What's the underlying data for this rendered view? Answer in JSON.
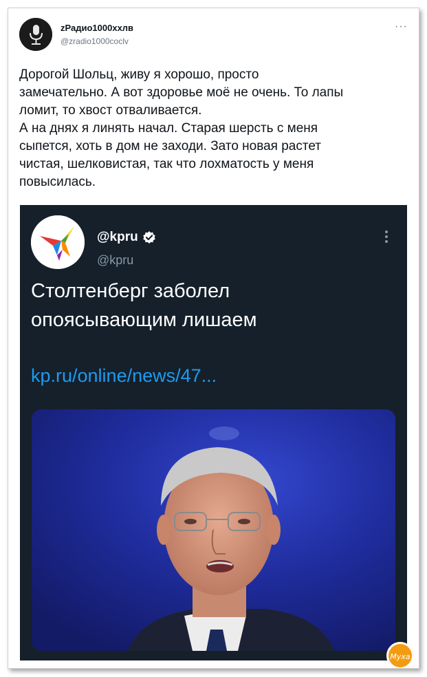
{
  "tweet": {
    "author": {
      "name": "zРадио1000ххлв",
      "handle": "@zradio1000coclv"
    },
    "more_label": "···",
    "text_lines": [
      "Дорогой Шольц, живу я хорошо, просто",
      "замечательно. А вот здоровье моё не очень. То лапы",
      "ломит, то хвост отваливается.",
      "А на днях я линять начал. Старая шерсть с меня",
      "сыпется, хоть в дом не заходи. Зато новая растет",
      "чистая, шелковистая, так что лохматость у меня",
      "повысилась."
    ]
  },
  "quoted": {
    "name": "@kpru",
    "handle": "@kpru",
    "verified": true,
    "text_lines": [
      "Столтенберг заболел",
      "опоясывающим лишаем"
    ],
    "link": "kp.ru/online/news/47..."
  },
  "watermark": "Муха",
  "colors": {
    "embed_bg": "#15202b",
    "link": "#1d9bf0",
    "verified": "#1d9bf0",
    "photo_bg": "#1d2a95"
  }
}
